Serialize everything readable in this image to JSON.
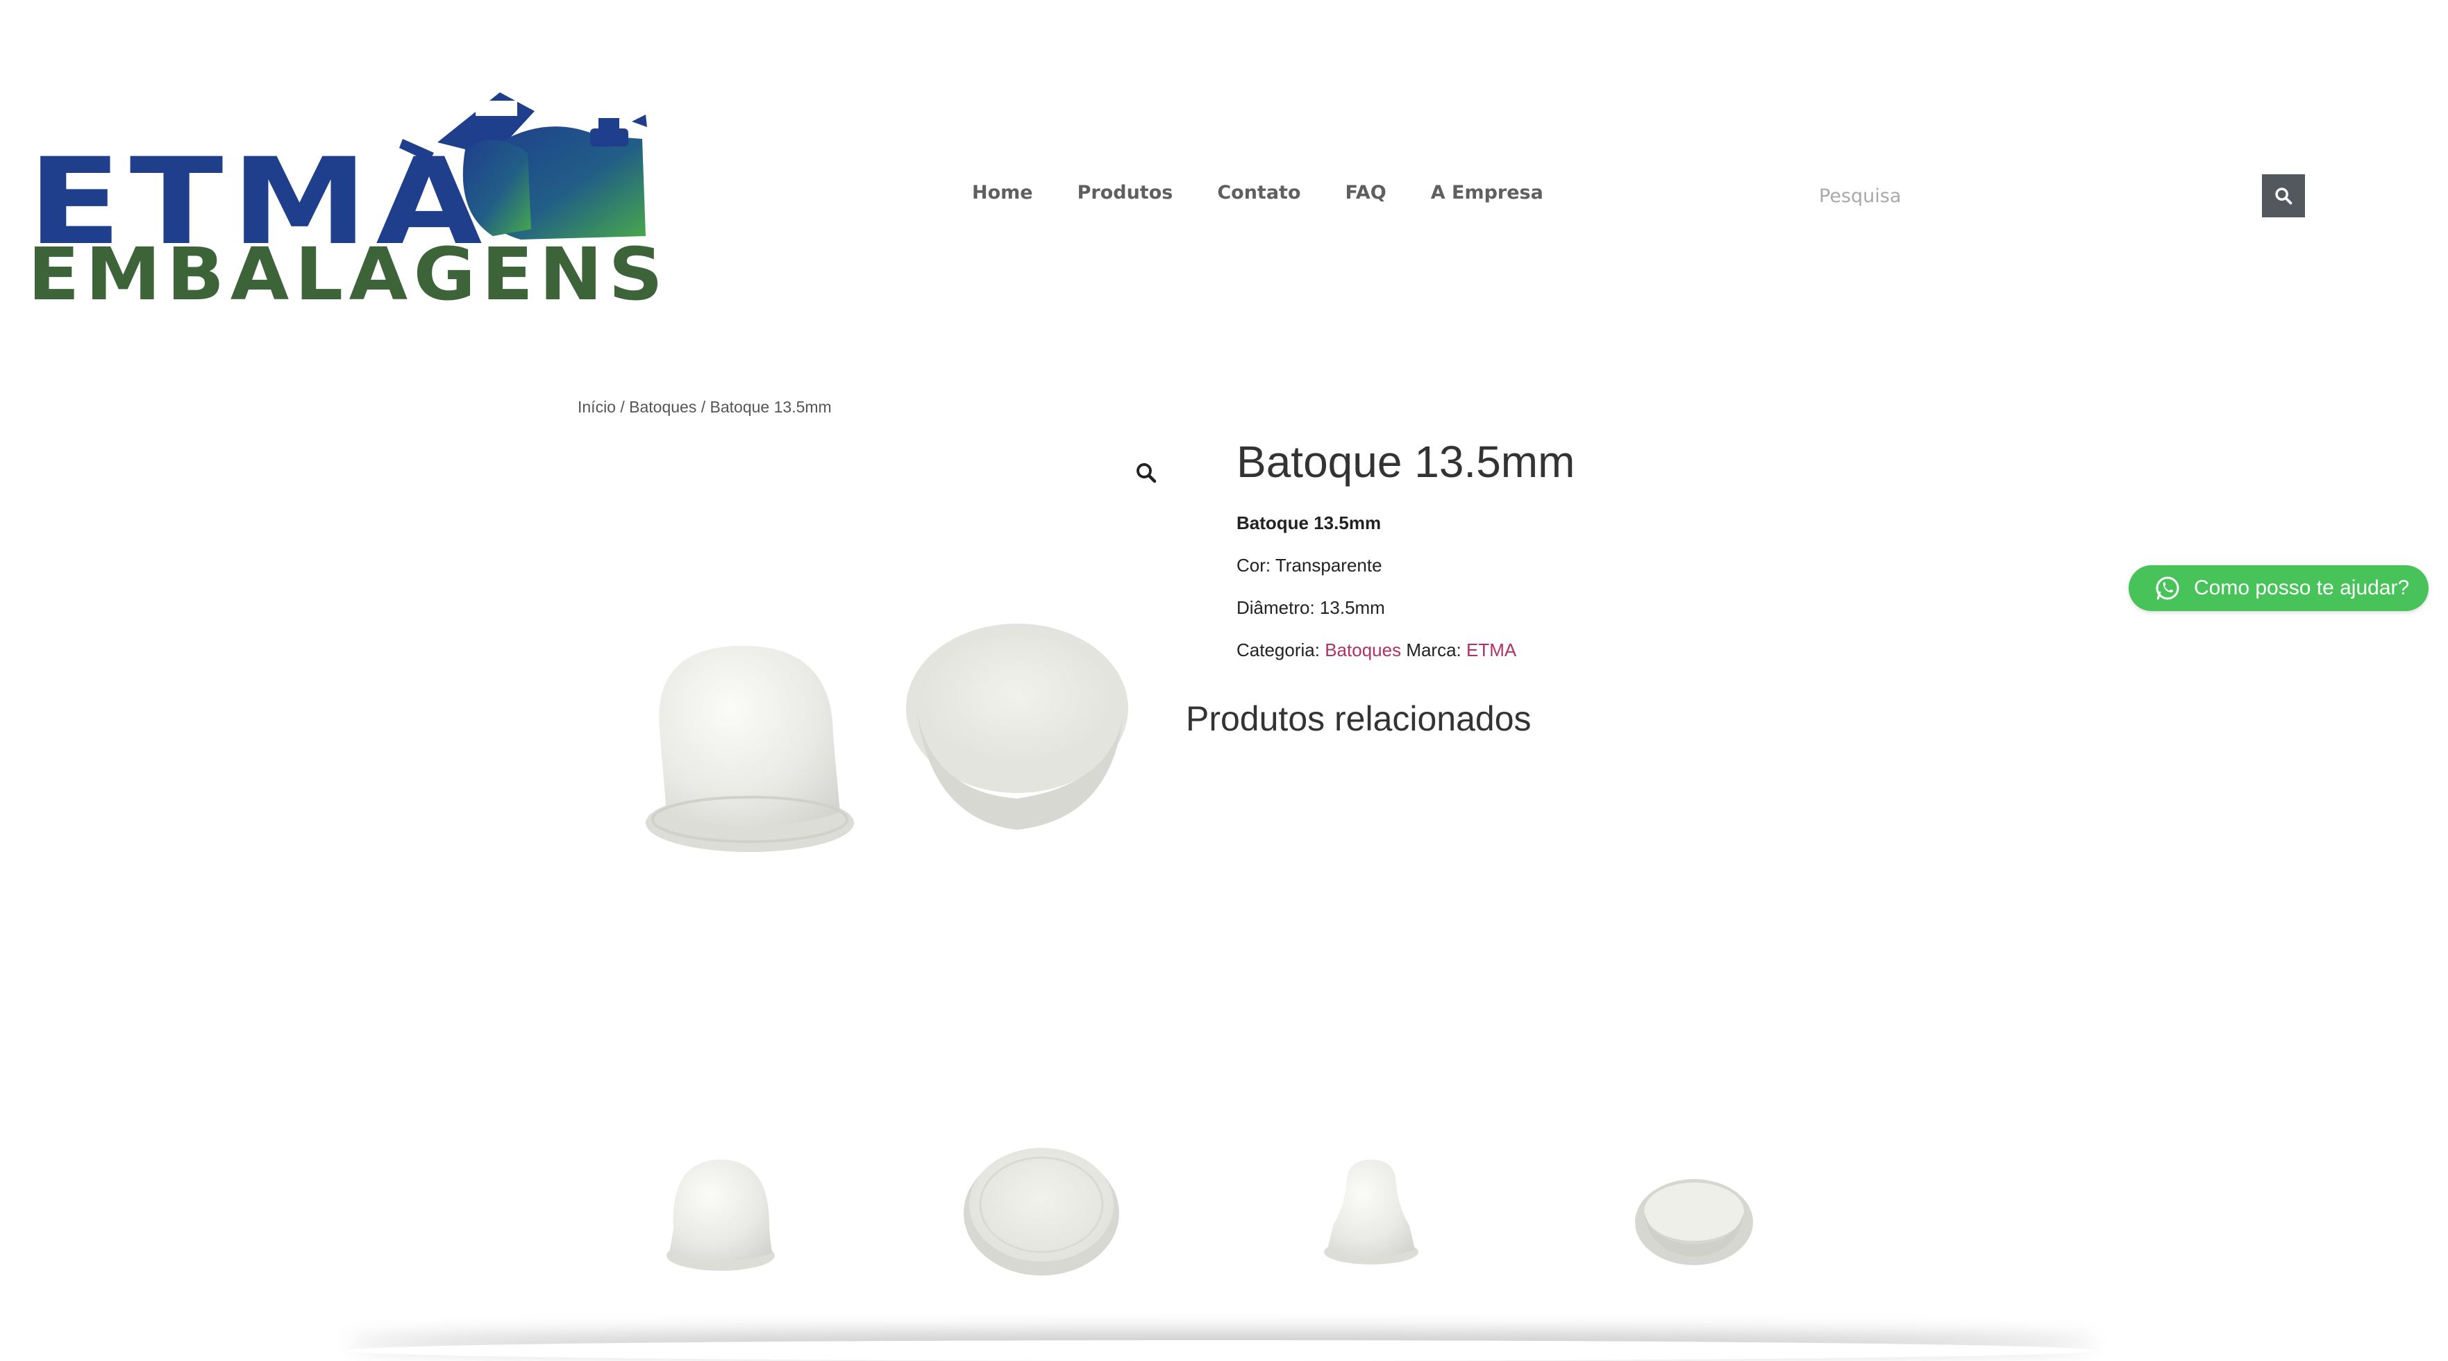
{
  "logo": {
    "line1": "ETMA",
    "line2": "EMBALAGENS"
  },
  "nav": {
    "items": [
      "Home",
      "Produtos",
      "Contato",
      "FAQ",
      "A Empresa"
    ]
  },
  "search": {
    "placeholder": "Pesquisa",
    "value": ""
  },
  "breadcrumb": {
    "home": "Início",
    "sep": " / ",
    "category": "Batoques",
    "current": "Batoque 13.5mm"
  },
  "product": {
    "title": "Batoque 13.5mm",
    "name_bold": "Batoque 13.5mm",
    "color": "Cor: Transparente",
    "diameter": "Diâmetro: 13.5mm",
    "category_label": "Categoria:",
    "category_link": "Batoques",
    "brand_label": "Marca:",
    "brand_link": "ETMA"
  },
  "related": {
    "title": "Produtos relacionados"
  },
  "whatsapp": {
    "label": "Como posso te ajudar?"
  },
  "colors": {
    "brand_blue": "#1f3e8c",
    "brand_green": "#3d6339",
    "link": "#b03262",
    "whatsapp": "#48c35a"
  }
}
